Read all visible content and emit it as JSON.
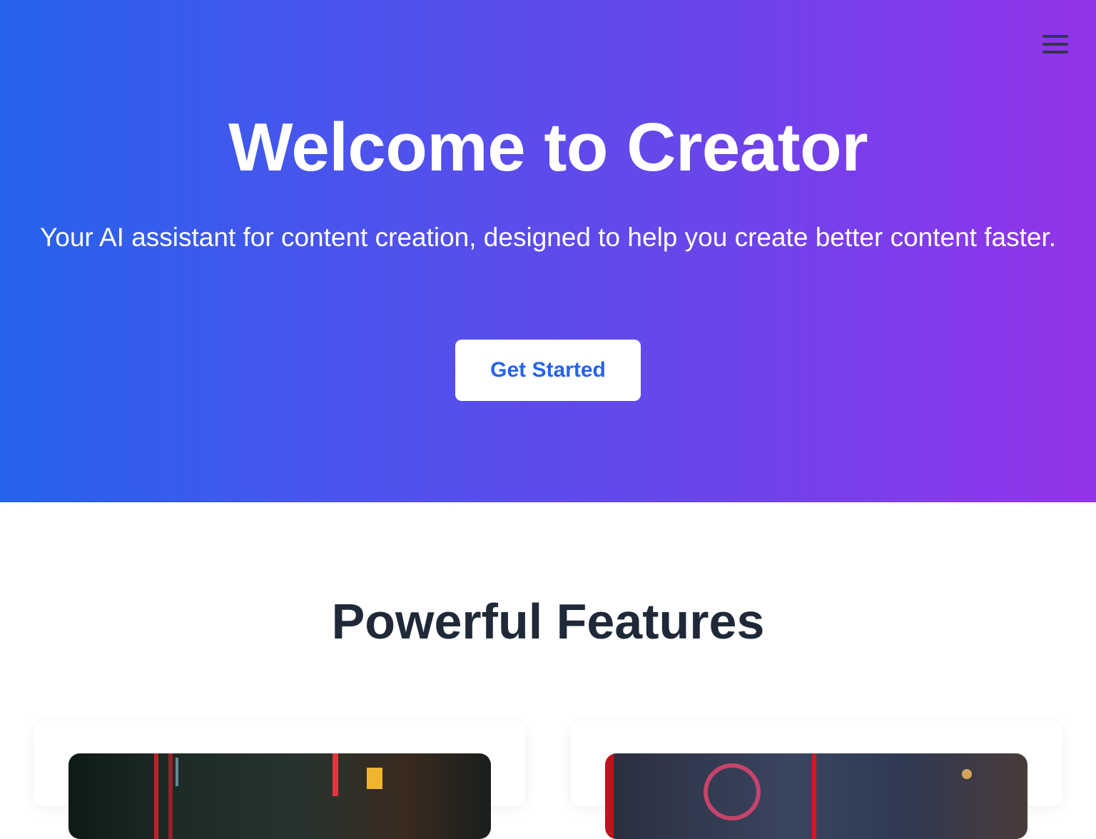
{
  "colors": {
    "hero_gradient_start": "#2563eb",
    "hero_gradient_end": "#9333ea",
    "cta_text": "#2563eb",
    "heading_dark": "#1f2937"
  },
  "nav": {
    "menu_icon": "hamburger-menu-icon"
  },
  "hero": {
    "title": "Welcome to Creator",
    "subtitle": "Your AI assistant for content creation, designed to help you create better content faster.",
    "cta_label": "Get Started"
  },
  "features": {
    "title": "Powerful Features",
    "cards": [
      {
        "image": "neon-city-street-photo"
      },
      {
        "image": "neon-robot-city-photo"
      }
    ]
  }
}
